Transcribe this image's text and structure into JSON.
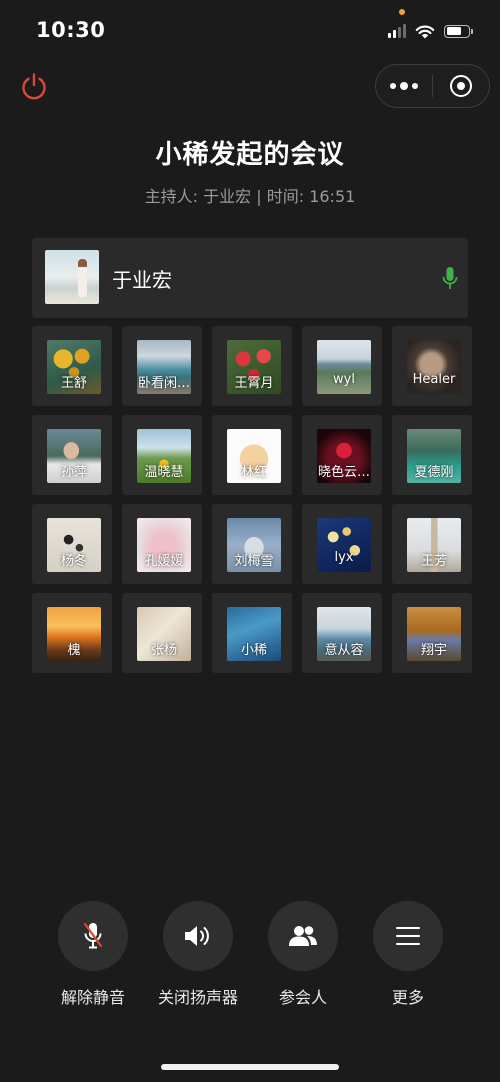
{
  "status_bar": {
    "time": "10:30"
  },
  "meeting": {
    "title": "小稀发起的会议",
    "subtitle": "主持人: 于业宏 | 时间: 16:51"
  },
  "host": {
    "name": "于业宏"
  },
  "participants": [
    {
      "name": "王舒",
      "avatar": "sunflowers-painting"
    },
    {
      "name": "卧看闲…",
      "avatar": "person-by-lake"
    },
    {
      "name": "王霄月",
      "avatar": "red-roses"
    },
    {
      "name": "wyl",
      "avatar": "mountain-lake"
    },
    {
      "name": "Healer",
      "avatar": "portrait-woman"
    },
    {
      "name": "孙萍",
      "avatar": "man-portrait"
    },
    {
      "name": "温晓慧",
      "avatar": "sunflower-field"
    },
    {
      "name": "林红",
      "avatar": "cartoon-baby"
    },
    {
      "name": "晓色云…",
      "avatar": "red-heart-lights"
    },
    {
      "name": "夏德刚",
      "avatar": "green-cliff-river"
    },
    {
      "name": "杨冬",
      "avatar": "calligraphy"
    },
    {
      "name": "孔媛媛",
      "avatar": "pink-lotus"
    },
    {
      "name": "刘梅雪",
      "avatar": "statue-sky"
    },
    {
      "name": "lyx",
      "avatar": "blue-flowers"
    },
    {
      "name": "王芳",
      "avatar": "city-tower"
    },
    {
      "name": "槐",
      "avatar": "sunset-sea"
    },
    {
      "name": "张杨",
      "avatar": "soft-light"
    },
    {
      "name": "小稀",
      "avatar": "blue-ocean"
    },
    {
      "name": "意从容",
      "avatar": "seaside-rocks"
    },
    {
      "name": "翔宇",
      "avatar": "tent-autumn"
    }
  ],
  "controls": {
    "unmute_label": "解除静音",
    "speaker_off_label": "关闭扬声器",
    "participants_label": "参会人",
    "more_label": "更多"
  },
  "colors": {
    "background": "#1b1b1b",
    "card": "#2a2a2a",
    "power_red": "#d9483b",
    "mic_green": "#3db24a",
    "muted_red": "#e0453a"
  }
}
